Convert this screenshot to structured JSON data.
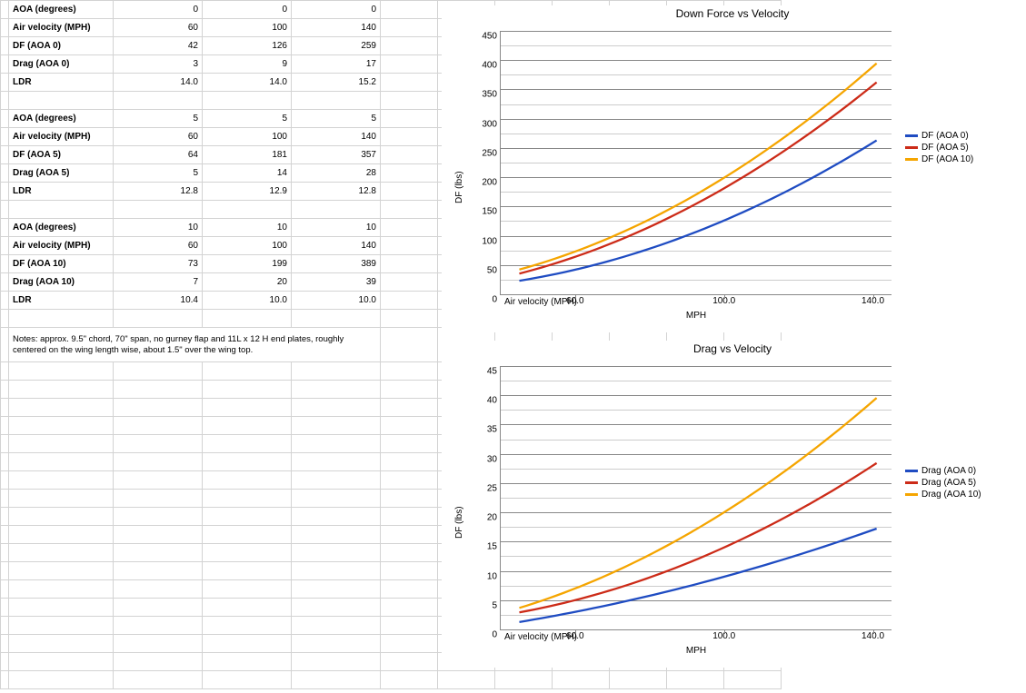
{
  "table": {
    "blocks": [
      {
        "rows": [
          {
            "label": "AOA (degrees)",
            "vals": [
              "0",
              "0",
              "0"
            ]
          },
          {
            "label": "Air velocity (MPH)",
            "vals": [
              "60",
              "100",
              "140"
            ]
          },
          {
            "label": "DF (AOA 0)",
            "vals": [
              "42",
              "126",
              "259"
            ]
          },
          {
            "label": "Drag (AOA 0)",
            "vals": [
              "3",
              "9",
              "17"
            ]
          },
          {
            "label": "LDR",
            "vals": [
              "14.0",
              "14.0",
              "15.2"
            ]
          }
        ]
      },
      {
        "rows": [
          {
            "label": "AOA (degrees)",
            "vals": [
              "5",
              "5",
              "5"
            ]
          },
          {
            "label": "Air velocity (MPH)",
            "vals": [
              "60",
              "100",
              "140"
            ]
          },
          {
            "label": "DF (AOA 5)",
            "vals": [
              "64",
              "181",
              "357"
            ]
          },
          {
            "label": "Drag (AOA 5)",
            "vals": [
              "5",
              "14",
              "28"
            ]
          },
          {
            "label": "LDR",
            "vals": [
              "12.8",
              "12.9",
              "12.8"
            ]
          }
        ]
      },
      {
        "rows": [
          {
            "label": "AOA (degrees)",
            "vals": [
              "10",
              "10",
              "10"
            ]
          },
          {
            "label": "Air velocity (MPH)",
            "vals": [
              "60",
              "100",
              "140"
            ]
          },
          {
            "label": "DF (AOA 10)",
            "vals": [
              "73",
              "199",
              "389"
            ]
          },
          {
            "label": "Drag (AOA 10)",
            "vals": [
              "7",
              "20",
              "39"
            ]
          },
          {
            "label": "LDR",
            "vals": [
              "10.4",
              "10.0",
              "10.0"
            ]
          }
        ]
      }
    ],
    "notes": "Notes: approx. 9.5\" chord, 70\" span, no gurney flap and 11L x 12 H end plates, roughly centered on the wing length wise, about 1.5\" over the wing top."
  },
  "charts": {
    "df": {
      "title": "Down Force vs Velocity",
      "ylabel": "DF (lbs)",
      "xlabel": "MPH",
      "x_inside_label": "Air velocity (MPH)",
      "legend": [
        {
          "name": "DF (AOA 0)",
          "color": "#1f4cc2"
        },
        {
          "name": "DF (AOA 5)",
          "color": "#cc2b18"
        },
        {
          "name": "DF (AOA 10)",
          "color": "#f5a500"
        }
      ]
    },
    "drag": {
      "title": "Drag vs Velocity",
      "ylabel": "DF (lbs)",
      "xlabel": "MPH",
      "x_inside_label": "Air velocity (MPH)",
      "legend": [
        {
          "name": "Drag (AOA 0)",
          "color": "#1f4cc2"
        },
        {
          "name": "Drag (AOA 5)",
          "color": "#cc2b18"
        },
        {
          "name": "Drag (AOA 10)",
          "color": "#f5a500"
        }
      ]
    }
  },
  "chart_data": [
    {
      "id": "df",
      "type": "line",
      "title": "Down Force vs Velocity",
      "xlabel": "MPH",
      "ylabel": "DF (lbs)",
      "x_ticks": [
        "60.0",
        "100.0",
        "140.0"
      ],
      "y_ticks": [
        0,
        50,
        100,
        150,
        200,
        250,
        300,
        350,
        400,
        450
      ],
      "ylim": [
        0,
        450
      ],
      "xlim": [
        40,
        145
      ],
      "series": [
        {
          "name": "DF (AOA 0)",
          "color": "#1f4cc2",
          "x": [
            60,
            100,
            140
          ],
          "y": [
            42,
            126,
            259
          ]
        },
        {
          "name": "DF (AOA 5)",
          "color": "#cc2b18",
          "x": [
            60,
            100,
            140
          ],
          "y": [
            64,
            181,
            357
          ]
        },
        {
          "name": "DF (AOA 10)",
          "color": "#f5a500",
          "x": [
            60,
            100,
            140
          ],
          "y": [
            73,
            199,
            389
          ]
        }
      ]
    },
    {
      "id": "drag",
      "type": "line",
      "title": "Drag vs Velocity",
      "xlabel": "MPH",
      "ylabel": "DF (lbs)",
      "x_ticks": [
        "60.0",
        "100.0",
        "140.0"
      ],
      "y_ticks": [
        0,
        5,
        10,
        15,
        20,
        25,
        30,
        35,
        40,
        45
      ],
      "ylim": [
        0,
        45
      ],
      "xlim": [
        40,
        145
      ],
      "series": [
        {
          "name": "Drag (AOA 0)",
          "color": "#1f4cc2",
          "x": [
            60,
            100,
            140
          ],
          "y": [
            3,
            9,
            17
          ]
        },
        {
          "name": "Drag (AOA 5)",
          "color": "#cc2b18",
          "x": [
            60,
            100,
            140
          ],
          "y": [
            5,
            14,
            28
          ]
        },
        {
          "name": "Drag (AOA 10)",
          "color": "#f5a500",
          "x": [
            60,
            100,
            140
          ],
          "y": [
            7,
            20,
            39
          ]
        }
      ]
    }
  ]
}
